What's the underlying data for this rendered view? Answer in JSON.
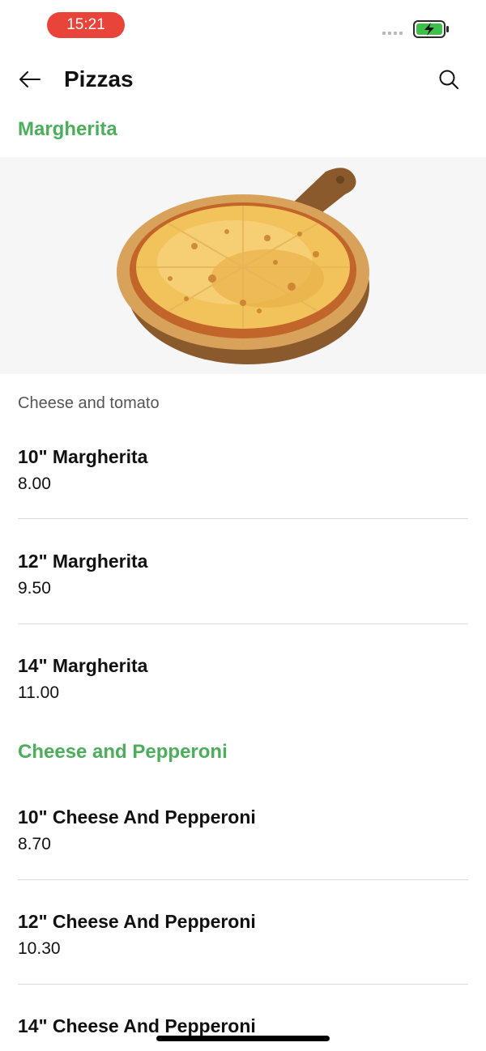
{
  "status_bar": {
    "time": "15:21"
  },
  "header": {
    "title": "Pizzas"
  },
  "sections": [
    {
      "title": "Margherita",
      "description": "Cheese and tomato",
      "items": [
        {
          "name": "10\" Margherita",
          "price": "8.00"
        },
        {
          "name": "12\" Margherita",
          "price": "9.50"
        },
        {
          "name": "14\" Margherita",
          "price": "11.00"
        }
      ]
    },
    {
      "title": "Cheese and Pepperoni",
      "items": [
        {
          "name": "10\" Cheese And Pepperoni",
          "price": "8.70"
        },
        {
          "name": "12\" Cheese And Pepperoni",
          "price": "10.30"
        },
        {
          "name": "14\" Cheese And Pepperoni",
          "price": ""
        }
      ]
    }
  ],
  "colors": {
    "accent": "#4cae5b",
    "time_pill": "#e8443a",
    "battery": "#3fc04a"
  }
}
